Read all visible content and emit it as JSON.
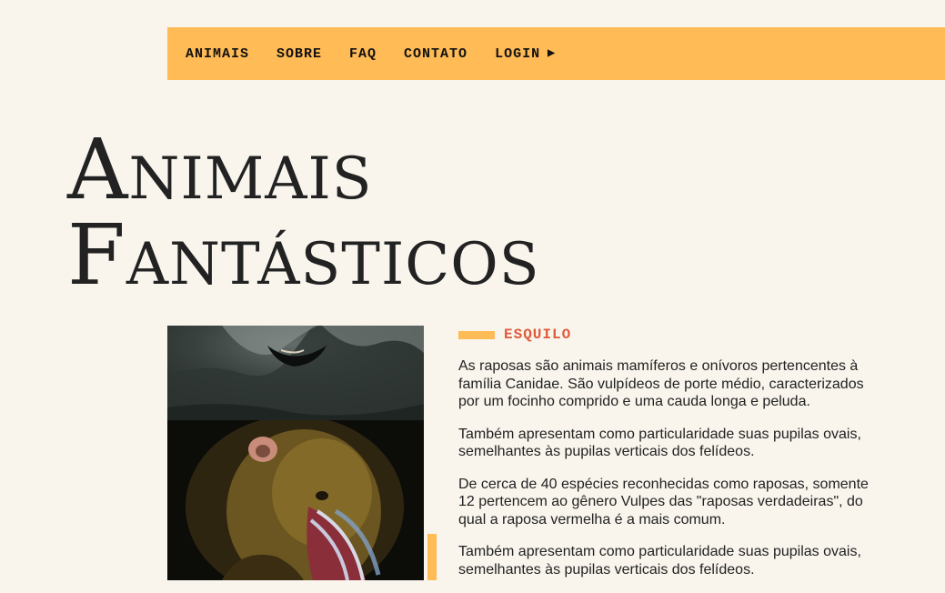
{
  "nav": {
    "items": [
      {
        "label": "ANIMAIS"
      },
      {
        "label": "SOBRE"
      },
      {
        "label": "FAQ"
      },
      {
        "label": "CONTATO"
      },
      {
        "label": "LOGIN"
      }
    ],
    "login_icon": "play-triangle-icon"
  },
  "hero": {
    "line1": "Animais",
    "line2": "Fantásticos"
  },
  "images": [
    {
      "subject": "wolf"
    },
    {
      "subject": "mandrill"
    }
  ],
  "section": {
    "label": "ESQUILO",
    "paragraphs": [
      "As raposas são animais mamíferos e onívoros pertencentes à família Canidae. São vulpídeos de porte médio, caracterizados por um focinho comprido e uma cauda longa e peluda.",
      "Também apresentam como particularidade suas pupilas ovais, semelhantes às pupilas verticais dos felídeos.",
      "De cerca de 40 espécies reconhecidas como raposas, somente 12 pertencem ao gênero Vulpes das \"raposas verdadeiras\", do qual a raposa vermelha é a mais comum.",
      "Também apresentam como particularidade suas pupilas ovais, semelhantes às pupilas verticais dos felídeos."
    ]
  },
  "colors": {
    "background": "#f9f5ed",
    "accent": "#ffbb55",
    "label": "#e05a3a",
    "text": "#222222"
  }
}
